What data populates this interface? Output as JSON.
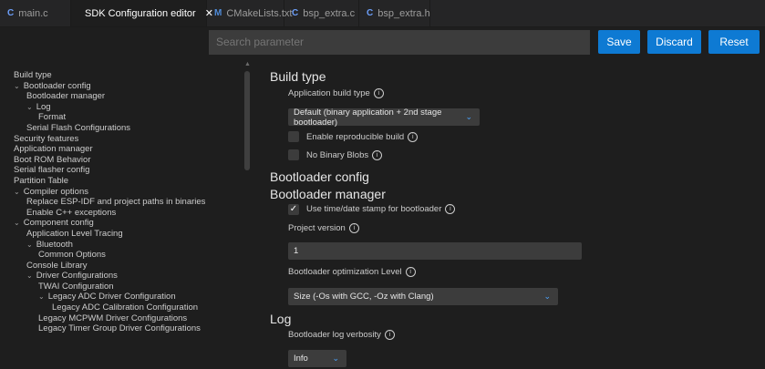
{
  "tabs": [
    {
      "icon": "C",
      "label": "main.c"
    },
    {
      "icon": "",
      "label": "SDK Configuration editor",
      "close": "✕"
    },
    {
      "icon": "M",
      "label": "CMakeLists.txt"
    },
    {
      "icon": "C",
      "label": "bsp_extra.c"
    },
    {
      "icon": "C",
      "label": "bsp_extra.h"
    }
  ],
  "search": {
    "placeholder": "Search parameter"
  },
  "buttons": {
    "save": "Save",
    "discard": "Discard",
    "reset": "Reset"
  },
  "sidebar": {
    "items": [
      {
        "label": "Build type",
        "chev": ""
      },
      {
        "label": "Bootloader config",
        "chev": "⌄"
      },
      {
        "label": "Bootloader manager",
        "chev": ""
      },
      {
        "label": "Log",
        "chev": "⌄"
      },
      {
        "label": "Format",
        "chev": ""
      },
      {
        "label": "Serial Flash Configurations",
        "chev": ""
      },
      {
        "label": "Security features",
        "chev": ""
      },
      {
        "label": "Application manager",
        "chev": ""
      },
      {
        "label": "Boot ROM Behavior",
        "chev": ""
      },
      {
        "label": "Serial flasher config",
        "chev": ""
      },
      {
        "label": "Partition Table",
        "chev": ""
      },
      {
        "label": "Compiler options",
        "chev": "⌄"
      },
      {
        "label": "Replace ESP-IDF and project paths in binaries",
        "chev": ""
      },
      {
        "label": "Enable C++ exceptions",
        "chev": ""
      },
      {
        "label": "Component config",
        "chev": "⌄"
      },
      {
        "label": "Application Level Tracing",
        "chev": ""
      },
      {
        "label": "Bluetooth",
        "chev": "⌄"
      },
      {
        "label": "Common Options",
        "chev": ""
      },
      {
        "label": "Console Library",
        "chev": ""
      },
      {
        "label": "Driver Configurations",
        "chev": "⌄"
      },
      {
        "label": "TWAI Configuration",
        "chev": ""
      },
      {
        "label": "Legacy ADC Driver Configuration",
        "chev": "⌄"
      },
      {
        "label": "Legacy ADC Calibration Configuration",
        "chev": ""
      },
      {
        "label": "Legacy MCPWM Driver Configurations",
        "chev": ""
      },
      {
        "label": "Legacy Timer Group Driver Configurations",
        "chev": ""
      }
    ]
  },
  "main": {
    "build_type_heading": "Build type",
    "app_build_type_label": "Application build type",
    "app_build_type_value": "Default (binary application + 2nd stage bootloader)",
    "reproducible_label": "Enable reproducible build",
    "no_binary_blobs_label": "No Binary Blobs",
    "bootloader_config_heading": "Bootloader config",
    "bootloader_manager_heading": "Bootloader manager",
    "timestamp_label": "Use time/date stamp for bootloader",
    "timestamp_checked": "✓",
    "project_version_label": "Project version",
    "project_version_value": "1",
    "opt_level_label": "Bootloader optimization Level",
    "opt_level_value": "Size (-Os with GCC, -Oz with Clang)",
    "log_heading": "Log",
    "log_verbosity_label": "Bootloader log verbosity",
    "log_verbosity_value": "Info",
    "info_glyph": "i",
    "dropdown_glyph": "⌄"
  },
  "colors": {
    "accent": "#0e7ad3",
    "background": "#1e1e1e",
    "tabbar": "#252526",
    "input": "#3c3c3c"
  }
}
